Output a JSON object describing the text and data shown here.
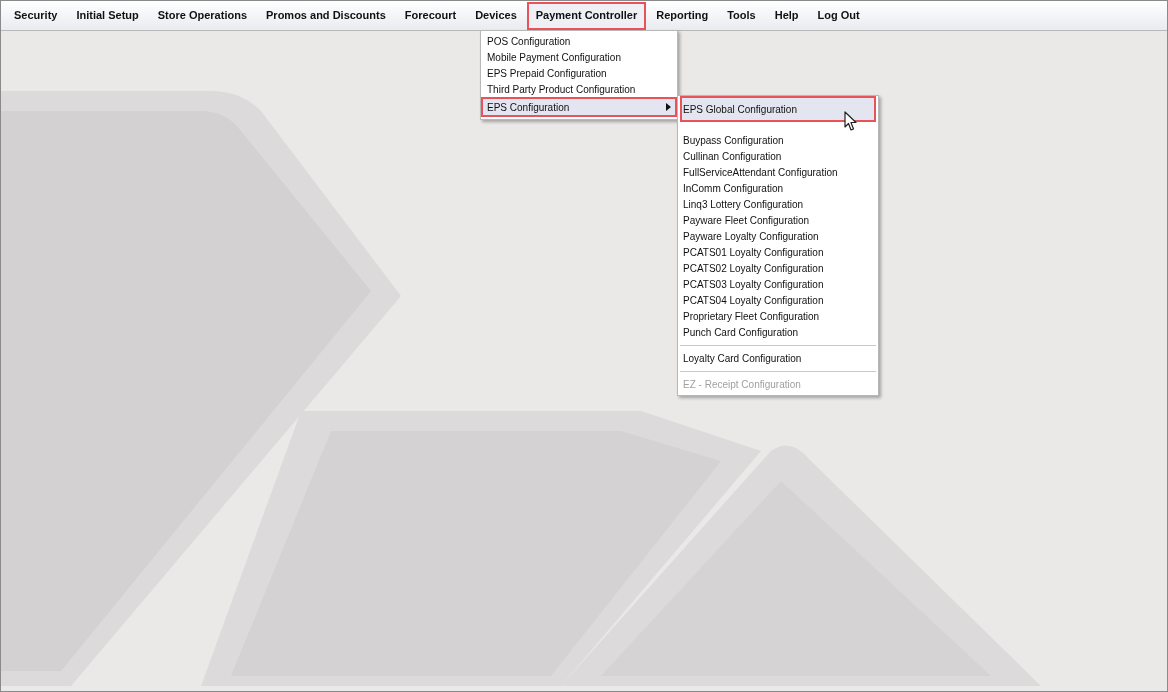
{
  "menubar": {
    "items": [
      {
        "label": "Security",
        "selected": false
      },
      {
        "label": "Initial Setup",
        "selected": false
      },
      {
        "label": "Store Operations",
        "selected": false
      },
      {
        "label": "Promos and Discounts",
        "selected": false
      },
      {
        "label": "Forecourt",
        "selected": false
      },
      {
        "label": "Devices",
        "selected": false
      },
      {
        "label": "Payment Controller",
        "selected": true
      },
      {
        "label": "Reporting",
        "selected": false
      },
      {
        "label": "Tools",
        "selected": false
      },
      {
        "label": "Help",
        "selected": false
      },
      {
        "label": "Log Out",
        "selected": false
      }
    ]
  },
  "dropdown": {
    "items": [
      {
        "label": "POS Configuration",
        "selected": false,
        "has_submenu": false
      },
      {
        "label": "Mobile Payment Configuration",
        "selected": false,
        "has_submenu": false
      },
      {
        "label": "EPS Prepaid Configuration",
        "selected": false,
        "has_submenu": false
      },
      {
        "label": "Third Party Product Configuration",
        "selected": false,
        "has_submenu": false
      },
      {
        "label": "EPS Configuration",
        "selected": true,
        "has_submenu": true
      }
    ]
  },
  "submenu": {
    "sections": [
      {
        "divider": false,
        "items": [
          {
            "label": "EPS Global Configuration",
            "selected": true,
            "disabled": false
          }
        ]
      },
      {
        "divider": false,
        "items": [
          {
            "label": "Buypass Configuration",
            "selected": false,
            "disabled": false
          },
          {
            "label": "Cullinan Configuration",
            "selected": false,
            "disabled": false
          },
          {
            "label": "FullServiceAttendant Configuration",
            "selected": false,
            "disabled": false
          },
          {
            "label": "InComm Configuration",
            "selected": false,
            "disabled": false
          },
          {
            "label": "Linq3 Lottery Configuration",
            "selected": false,
            "disabled": false
          },
          {
            "label": "Payware Fleet Configuration",
            "selected": false,
            "disabled": false
          },
          {
            "label": "Payware Loyalty Configuration",
            "selected": false,
            "disabled": false
          },
          {
            "label": "PCATS01 Loyalty Configuration",
            "selected": false,
            "disabled": false
          },
          {
            "label": "PCATS02 Loyalty Configuration",
            "selected": false,
            "disabled": false
          },
          {
            "label": "PCATS03 Loyalty Configuration",
            "selected": false,
            "disabled": false
          },
          {
            "label": "PCATS04 Loyalty Configuration",
            "selected": false,
            "disabled": false
          },
          {
            "label": "Proprietary Fleet Configuration",
            "selected": false,
            "disabled": false
          },
          {
            "label": "Punch Card Configuration",
            "selected": false,
            "disabled": false
          }
        ]
      },
      {
        "divider": true,
        "items": [
          {
            "label": "Loyalty Card Configuration",
            "selected": false,
            "disabled": false
          }
        ]
      },
      {
        "divider": true,
        "items": [
          {
            "label": "EZ - Receipt Configuration",
            "selected": false,
            "disabled": true
          }
        ]
      }
    ]
  }
}
